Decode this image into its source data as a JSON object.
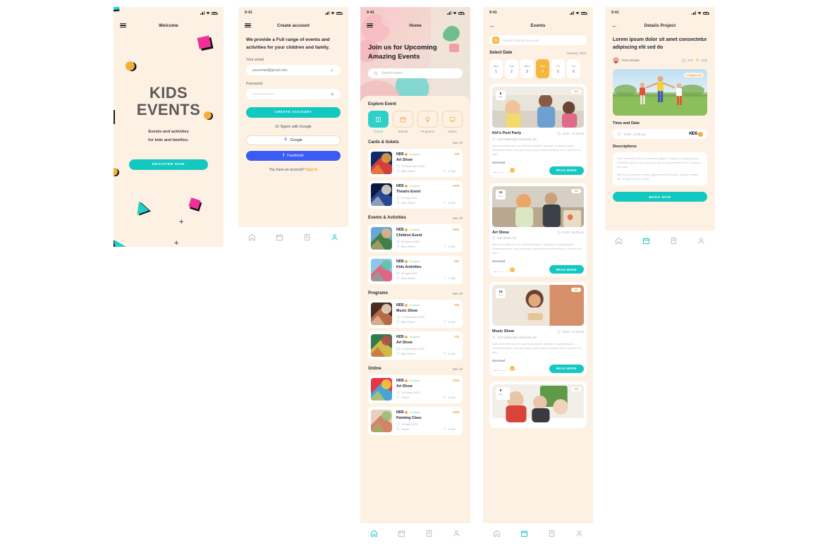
{
  "screens": {
    "welcome": {
      "status_time": "",
      "nav_title": "Welcome",
      "title_line1": "KIDS",
      "title_line2": "EVENTS",
      "sub_line1": "Events and activities",
      "sub_line2": "for kids and families.",
      "cta": "REGISTER NOW"
    },
    "create_account": {
      "status_time": "9:41",
      "nav_title": "Create account",
      "headline": "We provide a Full range of events and activities for your children and family.",
      "email_label": "Your email",
      "email_placeholder": "youremail@gmail.com",
      "password_label": "Password",
      "password_value": "••••••••••••••",
      "submit": "CREATE ACCOUNT",
      "or_text": "Or Signin with Google",
      "google": "Google",
      "facebook": "Facebook",
      "have_account": "You have an account?",
      "signin": "Sign In"
    },
    "home": {
      "status_time": "9:41",
      "nav_title": "Home",
      "hero_title": "Join us for Upcoming Amazing Events",
      "search_placeholder": "Search event",
      "explore_title": "Explore Event",
      "explore": [
        {
          "label": "Tickets",
          "icon": "ticket-icon",
          "active": true
        },
        {
          "label": "Events",
          "icon": "calendar-icon",
          "active": false
        },
        {
          "label": "Programs",
          "icon": "bulb-icon",
          "active": false
        },
        {
          "label": "Online",
          "icon": "monitor-icon",
          "active": false
        }
      ],
      "see_all": "See All",
      "sections": [
        {
          "title": "Cards & tickets",
          "items": [
            {
              "brand": "KIDS",
              "tag": "Go ahead",
              "title": "Art Show",
              "date": "31 December 2023",
              "place": "Mico Street",
              "votes": "1 Vote",
              "price": "70$"
            },
            {
              "brand": "KIDS",
              "tag": "Go ahead",
              "title": "Theatre Event",
              "date": "31 May 2023",
              "place": "Mico Street",
              "votes": "1 Vote",
              "price": "100$"
            }
          ]
        },
        {
          "title": "Events & Activities",
          "items": [
            {
              "brand": "KIDS",
              "tag": "Go ahead",
              "title": "Children Event",
              "date": "25 March 2023",
              "place": "Mico Street",
              "votes": "1 Vote",
              "price": "250$"
            },
            {
              "brand": "KIDS",
              "tag": "Go ahead",
              "title": "Kids Activities",
              "date": "15 April 2023",
              "place": "Mico Street",
              "votes": "1 Vote",
              "price": "50$"
            }
          ]
        },
        {
          "title": "Programs",
          "items": [
            {
              "brand": "KIDS",
              "tag": "Go ahead",
              "title": "Music Show",
              "date": "31 December 2023",
              "place": "Mico Street",
              "votes": "1 Vote",
              "price": "25$"
            },
            {
              "brand": "KIDS",
              "tag": "Go ahead",
              "title": "Art Show",
              "date": "11 November 2023",
              "place": "Mico Street",
              "votes": "1 Vote",
              "price": "70$"
            }
          ]
        },
        {
          "title": "Online",
          "items": [
            {
              "brand": "KIDS",
              "tag": "Go ahead",
              "title": "Art Show",
              "date": "15 March 2023",
              "place": "Online",
              "votes": "1 Vote",
              "price": "105$"
            },
            {
              "brand": "KIDS",
              "tag": "Go ahead",
              "title": "Painting Class",
              "date": "19 April 2023",
              "place": "Online",
              "votes": "1 Vote",
              "price": "165$"
            }
          ]
        }
      ]
    },
    "events": {
      "status_time": "9:41",
      "nav_title": "Events",
      "search_placeholder": "Search festivals & events",
      "select_date_label": "Select Date",
      "month": "January, 2023",
      "days": [
        {
          "day": "Mon",
          "num": "1",
          "active": false
        },
        {
          "day": "Tue",
          "num": "2",
          "active": false
        },
        {
          "day": "Wed",
          "num": "3",
          "active": false
        },
        {
          "day": "Thu",
          "num": "4",
          "active": true
        },
        {
          "day": "Fri",
          "num": "5",
          "active": false
        },
        {
          "day": "Sa",
          "num": "6",
          "active": false
        }
      ],
      "interested_label": "Interested",
      "read_more": "READ MORE",
      "more_avatars": "10+",
      "cards": [
        {
          "date_day": "8",
          "date_month": "May",
          "price": "45$",
          "title": "Kid's Pool Party",
          "time": "10:20 - 11:30 am",
          "location": "1247 Statesville Cleveland, NC",
          "desc": "Nam venenatis dui non commodo aliquet. Quisque eu gravida justo. Phasellus auctor, eros qui luctus, purus mauris eleifend est, in rutrum orci nibh."
        },
        {
          "date_day": "12",
          "date_month": "June",
          "price": "25$",
          "title": "Art Show",
          "time": "14:30 - 16:30 pm",
          "location": "Carl Street, NY",
          "desc": "Nam venenatis dui non commodo aliquet. Quisque eu gravida justo. Phasellus auctor, eros qui luctus, purus mauris eleifend est, in rutrum orci nibh."
        },
        {
          "date_day": "15",
          "date_month": "June",
          "price": "50$",
          "title": "Music Show",
          "time": "10:20 - 11:30 am",
          "location": "1247 Statesville Cleveland, NC",
          "desc": "Nam venenatis dui non commodo aliquet. Quisque eu gravida justo. Phasellus auctor, eros qui luctus, purus mauris eleifend est, in rutrum orci nibh."
        },
        {
          "date_day": "8",
          "date_month": "May",
          "price": "45$",
          "title": "",
          "time": "",
          "location": "",
          "desc": ""
        }
      ]
    },
    "details": {
      "status_time": "9:41",
      "nav_title": "Details Project",
      "title": "Lorem ipsum dolor sit amet consectetur adipiscing elit sed do",
      "author": "Paco Brown",
      "comments": "172",
      "likes": "1232",
      "image_tag": "12 Days Left",
      "time_section": "Time and Date",
      "time_value": "10:20 - 11:30 am",
      "brand": "KIDS",
      "desc_section": "Descriptions",
      "desc_p1": "Nam venenatis dui non commodo aliquet. Quisque eu gravida justo. Phasellus auctor, eros qui luctus, purus mauris eleifend est, in rutrum orci nibh.",
      "desc_p2": "Morbi a consectetur metus, eget fermentum turpis. Quisque massa nisl, feugiat id est at, porta.",
      "cta": "BOOK NOW"
    }
  },
  "bottom_nav": {
    "items": [
      {
        "icon": "home-icon",
        "name": "home"
      },
      {
        "icon": "calendar-icon",
        "name": "calendar"
      },
      {
        "icon": "document-icon",
        "name": "documents"
      },
      {
        "icon": "profile-icon",
        "name": "profile"
      }
    ]
  },
  "colors": {
    "background": "#fdf1e3",
    "teal": "#12c8c0",
    "orange": "#f6b73f",
    "pink": "#f0309a",
    "blue": "#3b5bf5"
  }
}
